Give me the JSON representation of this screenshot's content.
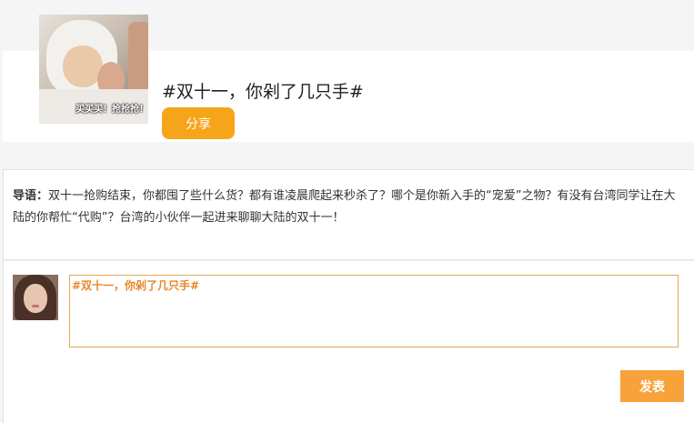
{
  "topic": {
    "cover_caption": "买买买！抢抢抢！",
    "title": "#双十一，你剁了几只手#",
    "share_label": "分享"
  },
  "intro": {
    "label": "导语：",
    "text": "双十一抢购结束，你都囤了些什么货？都有谁凌晨爬起来秒杀了？哪个是你新入手的“宠爱”之物？有没有台湾同学让在大陆的你帮忙“代购”？台湾的小伙伴一起进来聊聊大陆的双十一！"
  },
  "comment": {
    "value": "#双十一，你剁了几只手#",
    "submit_label": "发表"
  },
  "colors": {
    "share_button": "#f6a51b",
    "submit_button": "#f7a23a",
    "input_border": "#e8a55b",
    "input_text": "#e8862a"
  }
}
